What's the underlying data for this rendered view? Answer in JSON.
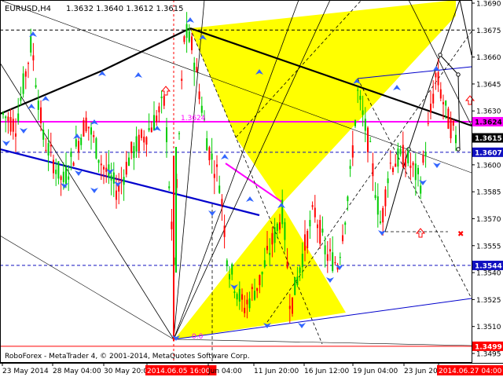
{
  "header": {
    "symbol_timeframe": "EURUSD,H4",
    "ohlc": "1.3632 1.3640 1.3612 1.3615"
  },
  "footer": {
    "copyright": "RoboForex - MetaTrader 4, © 2001-2014, MetaQuotes Software Corp."
  },
  "annotations": {
    "fib_label": "1.3624",
    "zero_label": "0.0"
  },
  "chart_data": {
    "type": "candlestick",
    "symbol": "EURUSD",
    "timeframe": "H4",
    "ylim": [
      1.349,
      1.37
    ],
    "price_ticks": [
      "1.3690",
      "1.3675",
      "1.3660",
      "1.3645",
      "1.3630",
      "1.3600",
      "1.3585",
      "1.3570",
      "1.3555",
      "1.3540",
      "1.3525",
      "1.3510",
      "1.3495"
    ],
    "price_tags": [
      {
        "label": "1.3624",
        "value": 1.3624,
        "color": "#ff00ff",
        "text_color": "#000000"
      },
      {
        "label": "1.3615",
        "value": 1.3615,
        "color": "#000000",
        "text_color": "#ffffff"
      },
      {
        "label": "1.3607",
        "value": 1.3607,
        "color": "#1010c0",
        "text_color": "#ffffff"
      },
      {
        "label": "1.3544",
        "value": 1.3544,
        "color": "#1010c0",
        "text_color": "#ffffff"
      },
      {
        "label": "1.3499",
        "value": 1.3499,
        "color": "#ff0000",
        "text_color": "#ffffff"
      }
    ],
    "time_labels": [
      "23 May 2014",
      "28 May 04:00",
      "30 May 20:00",
      "2014.06.05 16:00",
      "Jun 04:00",
      "11 Jun 20:00",
      "16 Jun 12:00",
      "19 Jun 04:00",
      "23 Jun 20:00",
      "2014.06.27 04:00"
    ],
    "highlighted_time_labels": [
      "2014.06.05 16:00",
      "2014.06.27 04:00"
    ],
    "colors": {
      "bull": "#00cc00",
      "bear": "#ff0000",
      "triangles": "#ffff00",
      "magenta": "#ff00ff",
      "trend_blue": "#0000cc",
      "arrows": "#3366ff",
      "frame": "#000000"
    }
  }
}
